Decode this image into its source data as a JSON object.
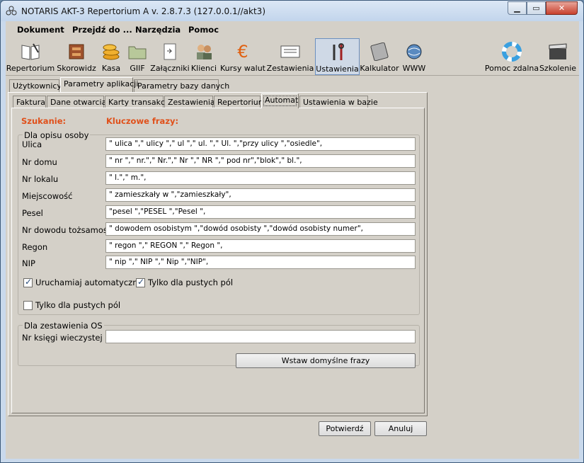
{
  "window": {
    "title": "NOTARIS AKT-3 Repertorium A v. 2.8.7.3 (127.0.0.1//akt3)"
  },
  "menu": [
    "Dokument",
    "Przejdź do ...",
    "Narzędzia",
    "Pomoc"
  ],
  "toolbar": [
    {
      "label": "Repertorium",
      "icon": "book-icon"
    },
    {
      "label": "Skorowidz",
      "icon": "drawer-icon"
    },
    {
      "label": "Kasa",
      "icon": "coins-icon"
    },
    {
      "label": "GIIF",
      "icon": "folder-icon"
    },
    {
      "label": "Załączniki",
      "icon": "attachment-icon"
    },
    {
      "label": "Klienci",
      "icon": "clients-icon"
    },
    {
      "label": "Kursy walut",
      "icon": "euro-icon"
    },
    {
      "label": "Zestawienia",
      "icon": "report-icon"
    },
    {
      "label": "Ustawienia",
      "icon": "tools-icon"
    },
    {
      "label": "Kalkulator",
      "icon": "calculator-icon"
    },
    {
      "label": "WWW",
      "icon": "globe-icon"
    },
    {
      "label": "Pomoc zdalna",
      "icon": "lifebuoy-icon"
    },
    {
      "label": "Szkolenie",
      "icon": "clapper-icon"
    }
  ],
  "tabs_top": [
    "Użytkownicy",
    "Parametry aplikacji",
    "Parametry bazy danych"
  ],
  "tabs_sub": [
    "Faktura",
    "Dane otwarcia",
    "Karty transakcji",
    "Zestawienia",
    "Repertorium",
    "Automat",
    "Ustawienia w bazie"
  ],
  "header": {
    "search": "Szukanie:",
    "keys": "Kluczowe frazy:"
  },
  "group1": {
    "title": "Dla opisu osoby",
    "rows": [
      {
        "label": "Ulica",
        "value": "\" ulica \",\" ulicy \",\" ul \",\" ul. \",\" Ul. \",\"przy ulicy \",\"osiedle\","
      },
      {
        "label": "Nr domu",
        "value": "\" nr \",\" nr.\",\" Nr.\",\" Nr \",\" NR \",\" pod nr\",\"blok\",\" bl.\","
      },
      {
        "label": "Nr lokalu",
        "value": "\" l.\",\" m.\","
      },
      {
        "label": "Miejscowość",
        "value": "\" zamieszkały w \",\"zamieszkały\","
      },
      {
        "label": "Pesel",
        "value": "\"pesel \",\"PESEL \",\"Pesel \","
      },
      {
        "label": "Nr dowodu tożsamości",
        "value": "\" dowodem osobistym \",\"dowód osobisty \",\"dowód osobisty numer\","
      },
      {
        "label": "Regon",
        "value": "\" regon \",\" REGON \",\" Regon \","
      },
      {
        "label": "NIP",
        "value": "\" nip \",\" NIP \",\" Nip \",\"NIP\","
      }
    ],
    "cb1": "Uruchamiaj automatycznie",
    "cb2": "Tylko dla pustych pól",
    "cb3": "Tylko dla pustych pól"
  },
  "group2": {
    "title": "Dla zestawienia OS",
    "label": "Nr księgi wieczystej",
    "value": ""
  },
  "buttons": {
    "defaults": "Wstaw domyślne frazy",
    "confirm": "Potwierdź",
    "cancel": "Anuluj"
  }
}
